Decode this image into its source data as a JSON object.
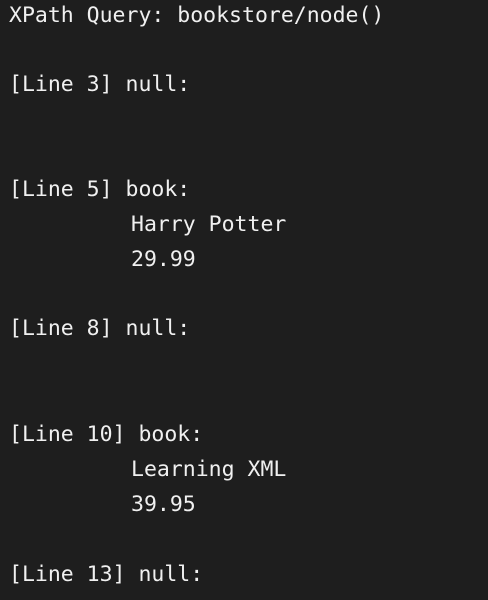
{
  "terminal": {
    "query": "XPath Query: bookstore/node()",
    "results": [
      {
        "header": "[Line 3] null:",
        "values": []
      },
      {
        "header": "[Line 5] book:",
        "values": [
          "Harry Potter",
          "29.99"
        ]
      },
      {
        "header": "[Line 8] null:",
        "values": []
      },
      {
        "header": "[Line 10] book:",
        "values": [
          "Learning XML",
          "39.95"
        ]
      },
      {
        "header": "[Line 13] null:",
        "values": []
      }
    ]
  }
}
